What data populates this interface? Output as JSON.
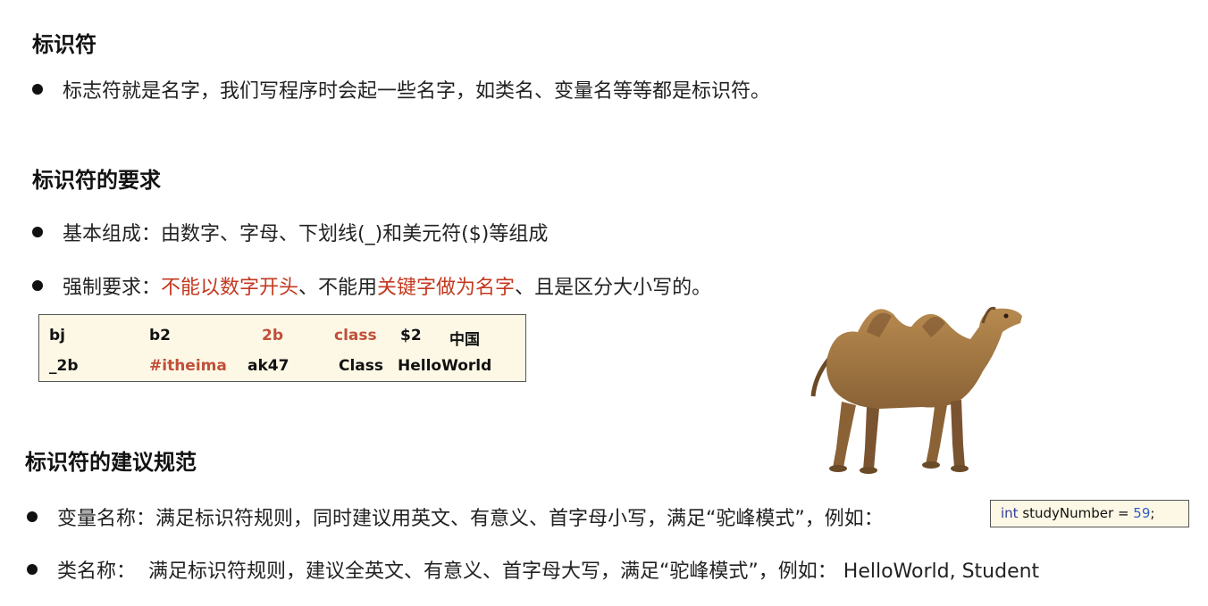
{
  "section1": {
    "heading": "标识符",
    "bullet": "标志符就是名字，我们写程序时会起一些名字，如类名、变量名等等都是标识符。"
  },
  "section2": {
    "heading": "标识符的要求",
    "bullet1": "基本组成：由数字、字母、下划线(_)和美元符($)等组成",
    "bullet2": {
      "prefix": "强制要求：",
      "red1": "不能以数字开头",
      "mid": "、不能用",
      "red2": "关键字做为名字",
      "suffix": "、且是区分大小写的。"
    },
    "examples": {
      "row1": [
        "bj",
        "b2",
        "2b",
        "class",
        "$2",
        "中国"
      ],
      "row2": [
        "_2b",
        "#itheima",
        "ak47",
        "Class",
        "HelloWorld"
      ]
    }
  },
  "section3": {
    "heading": "标识符的建议规范",
    "bullet1": "变量名称：满足标识符规则，同时建议用英文、有意义、首字母小写，满足“驼峰模式”，例如：",
    "code": {
      "keyword": "int",
      "name": " studyNumber = ",
      "value": "59",
      "end": ";"
    },
    "bullet2": "类名称：  满足标识符规则，建议全英文、有意义、首字母大写，满足“驼峰模式”，例如： HelloWorld, Student"
  },
  "colors": {
    "accent_red": "#c4381f",
    "invalid_example": "#c0503a",
    "box_bg": "#fdf8e6"
  },
  "image": "camel-illustration"
}
